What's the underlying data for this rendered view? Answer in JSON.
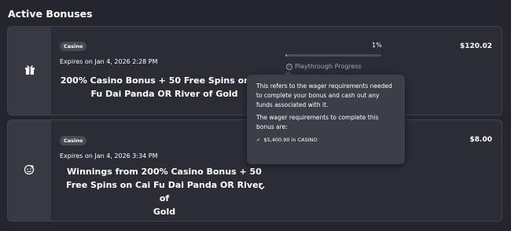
{
  "section": {
    "title": "Active Bonuses"
  },
  "bonuses": [
    {
      "tag": "Casino",
      "icon": "gift-box-icon",
      "expires": "Expires on Jan 4, 2026 2:28 PM",
      "title_line1": "200% Casino Bonus + 50 Free Spins on Cai",
      "title_line2": "Fu Dai Panda OR River of Gold",
      "amount": "$120.02",
      "progress_percent_label": "1%",
      "progress_value": 1,
      "progress_label": "Playthrough Progress"
    },
    {
      "tag": "Casino",
      "icon": "winnings-smiley-icon",
      "expires": "Expires on Jan 4, 2026 3:34 PM",
      "title_line1": "Winnings from 200% Casino Bonus + 50",
      "title_line2": "Free Spins on Cai Fu Dai Panda OR River of",
      "title_line3": "Gold",
      "amount": "$8.00"
    }
  ],
  "tooltip": {
    "para1": "This refers to the wager requirements needed to complete your bonus and cash out any funds associated with it.",
    "para2": "The wager requirements to complete this bonus are:",
    "requirement": "$5,400.90 in CASINO"
  },
  "colors": {
    "progress": "#2fc38c",
    "background": "#25252d",
    "card": "#2c2c35"
  }
}
